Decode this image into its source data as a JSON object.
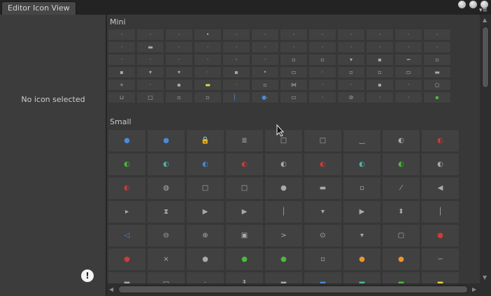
{
  "window": {
    "tab_title": "Editor Icon View",
    "buttons": [
      "close-button",
      "maximize-button",
      "minimize-button"
    ]
  },
  "left_panel": {
    "status_text": "No icon selected",
    "info_glyph": "!"
  },
  "sections": {
    "mini": {
      "title": "Mini",
      "rows": [
        [
          "·",
          "·",
          "·",
          "•",
          "·",
          "·",
          "·",
          "·",
          "·",
          "·",
          "·",
          "·"
        ],
        [
          "·",
          "▬",
          "·",
          "·",
          "·",
          "·",
          "·",
          "·",
          "·",
          "·",
          "·",
          "·"
        ],
        [
          "·",
          "·",
          "·",
          "·",
          "◦",
          "·",
          "▫",
          "▫",
          "▾",
          "▪",
          "━",
          "▫"
        ],
        [
          "▪",
          "▾",
          "▾",
          "·",
          "▪",
          "•",
          "▭",
          "·",
          "▫",
          "▫",
          "▭",
          "▬"
        ],
        [
          "+",
          "·",
          "▪",
          "▬",
          "·",
          "▫",
          "⋈",
          "·",
          "·",
          "▪",
          "·",
          "○"
        ],
        [
          "⊔",
          "□",
          "▫",
          "▫",
          "▏",
          "●-",
          "▭",
          "·",
          "⊘",
          "·",
          "·",
          "▪"
        ]
      ]
    },
    "small": {
      "title": "Small",
      "rows": [
        [
          "●",
          "●",
          "🔒",
          "≣",
          "□",
          "□",
          "‿",
          "◐",
          "◐"
        ],
        [
          "◐",
          "◐",
          "◐",
          "◐",
          "◐",
          "◐",
          "◐",
          "◐",
          "◐"
        ],
        [
          "◐",
          "◍",
          "□",
          "□",
          "●",
          "▬",
          "▫",
          "⁄",
          "◀"
        ],
        [
          "▸",
          "⧗",
          "▶",
          "▶",
          "│",
          "▾",
          "▶",
          "⬍",
          "│"
        ],
        [
          "◁",
          "⊖",
          "⊕",
          "▣",
          ">",
          "⊙",
          "▾",
          "▢",
          "●"
        ],
        [
          "●",
          "×",
          "●",
          "●",
          "●",
          "▫",
          "●",
          "●",
          "−"
        ],
        [
          "▬",
          "▭",
          "·",
          "⇞",
          "▬",
          "▬",
          "▬",
          "▬",
          "▬"
        ]
      ]
    }
  },
  "colors": {
    "panel_bg": "#3c3c3c",
    "content_bg": "#383838",
    "cell_bg": "#414141",
    "blue": "#4a8ad8",
    "red": "#d23a3a",
    "green": "#4cba3c",
    "yellow": "#e8d63a",
    "teal": "#4cb8a8",
    "orange": "#e8962a"
  }
}
